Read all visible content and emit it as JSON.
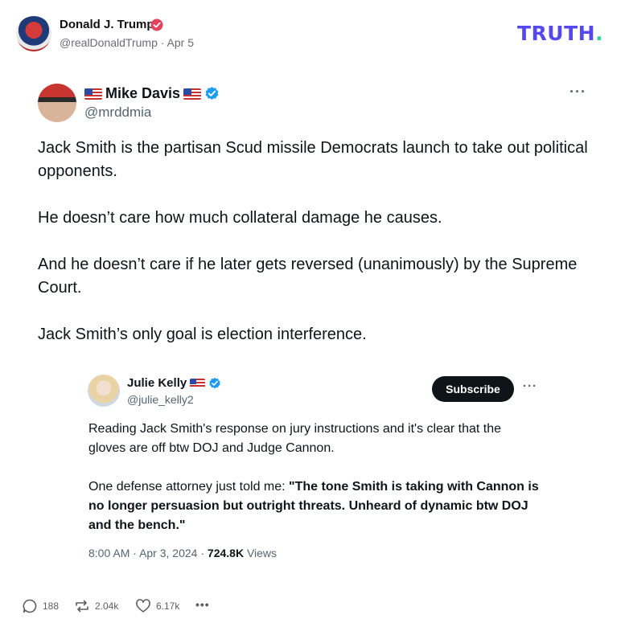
{
  "post": {
    "author_name": "Donald J. Trump",
    "author_handle": "@realDonaldTrump",
    "separator": "·",
    "date": "Apr 5",
    "brand": {
      "text": "TRUTH",
      "dot": ".",
      "color": "#5448ee",
      "dot_color": "#34d399"
    }
  },
  "embedded_tweet": {
    "name": "Mike Davis",
    "handle": "@mrddmia",
    "more_label": "···",
    "paragraphs": [
      "Jack Smith is the partisan Scud missile Democrats launch to take out political opponents.",
      "He doesn’t care how much collateral damage he causes.",
      "And he doesn’t care if he later gets reversed (unanimously) by the Supreme Court.",
      "Jack Smith’s only goal is election interference."
    ]
  },
  "quoted_tweet": {
    "name": "Julie Kelly",
    "handle": "@julie_kelly2",
    "subscribe_label": "Subscribe",
    "more_label": "···",
    "paragraph_1": "Reading Jack Smith's response on jury instructions and it's clear that the gloves are off btw DOJ and Judge Cannon.",
    "paragraph_2_prefix": "One defense attorney just told me: ",
    "paragraph_2_bold": "\"The tone Smith is taking with Cannon is no longer persuasion but outright threats. Unheard of dynamic btw DOJ and the bench.\"",
    "time": "8:00 AM",
    "date": "Apr 3, 2024",
    "views_count": "724.8K",
    "views_label": "Views",
    "separator": "·"
  },
  "actions": {
    "replies": "188",
    "retruths": "2.04k",
    "likes": "6.17k",
    "more_label": "•••"
  },
  "icons": {
    "verified_pink": "verified-badge-pink",
    "verified_blue": "verified-badge-blue",
    "reply": "comment-icon",
    "retruth": "retruth-icon",
    "like": "heart-icon",
    "more": "more-icon"
  },
  "colors": {
    "verified_pink": "#e4405f",
    "verified_blue": "#1d9bf0"
  }
}
